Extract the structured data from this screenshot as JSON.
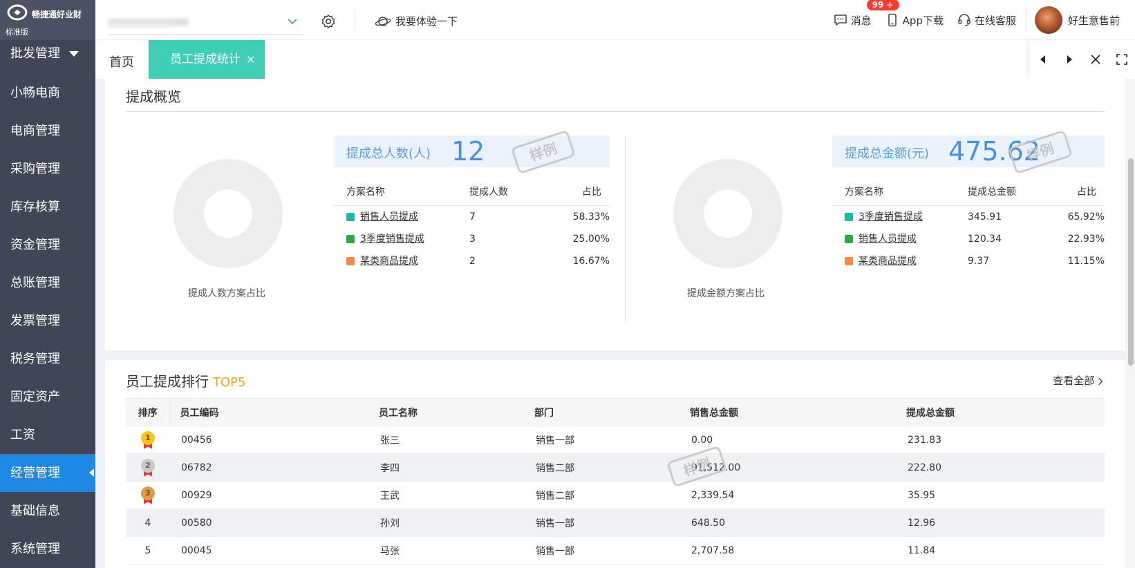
{
  "brand": {
    "name": "畅捷通好业财",
    "edition": "标准版"
  },
  "sidebar": {
    "items": [
      {
        "label": "批发管理"
      },
      {
        "label": "小畅电商"
      },
      {
        "label": "电商管理"
      },
      {
        "label": "采购管理"
      },
      {
        "label": "库存核算"
      },
      {
        "label": "资金管理"
      },
      {
        "label": "总账管理"
      },
      {
        "label": "发票管理"
      },
      {
        "label": "税务管理"
      },
      {
        "label": "固定资产"
      },
      {
        "label": "工资"
      },
      {
        "label": "经营管理"
      },
      {
        "label": "基础信息"
      },
      {
        "label": "系统管理"
      }
    ],
    "active_index": 11
  },
  "header": {
    "try_label": "我要体验一下",
    "messages_label": "消息",
    "messages_badge": "99 +",
    "app_download_label": "App下载",
    "service_label": "在线客服",
    "username": "好生意售前"
  },
  "tabs": {
    "home_label": "首页",
    "active_label": "员工提成统计",
    "close_glyph": "×"
  },
  "overview": {
    "title": "提成概览",
    "stamp_text": "样例",
    "people": {
      "caption": "提成人数方案占比",
      "stat_label": "提成总人数(人)",
      "stat_value": "12",
      "headers": [
        "方案名称",
        "提成人数",
        "占比"
      ],
      "rows": [
        {
          "name": "销售人员提成",
          "value": "7",
          "pct": "58.33%",
          "color": "#1fb8a8"
        },
        {
          "name": "3季度销售提成",
          "value": "3",
          "pct": "25.00%",
          "color": "#2ca843"
        },
        {
          "name": "某类商品提成",
          "value": "2",
          "pct": "16.67%",
          "color": "#f58c42"
        }
      ]
    },
    "amount": {
      "caption": "提成金额方案占比",
      "stat_label": "提成总金额(元)",
      "stat_value": "475.62",
      "headers": [
        "方案名称",
        "提成总金额",
        "占比"
      ],
      "rows": [
        {
          "name": "3季度销售提成",
          "value": "345.91",
          "pct": "65.92%",
          "color": "#1fb8a8"
        },
        {
          "name": "销售人员提成",
          "value": "120.34",
          "pct": "22.93%",
          "color": "#2ca843"
        },
        {
          "name": "某类商品提成",
          "value": "9.37",
          "pct": "11.15%",
          "color": "#f58c42"
        }
      ]
    }
  },
  "ranking": {
    "title": "员工提成排行",
    "title_suffix": "TOP5",
    "view_all": "查看全部",
    "headers": [
      "排序",
      "员工编码",
      "员工名称",
      "部门",
      "销售总金额",
      "提成总金额"
    ],
    "rows": [
      {
        "rank": "1",
        "medal": "gold",
        "code": "00456",
        "name": "张三",
        "dept": "销售一部",
        "sales": "0.00",
        "commission": "231.83"
      },
      {
        "rank": "2",
        "medal": "silver",
        "code": "06782",
        "name": "李四",
        "dept": "销售二部",
        "sales": "91,512.00",
        "commission": "222.80"
      },
      {
        "rank": "3",
        "medal": "bronze",
        "code": "00929",
        "name": "王武",
        "dept": "销售二部",
        "sales": "2,339.54",
        "commission": "35.95"
      },
      {
        "rank": "4",
        "medal": "",
        "code": "00580",
        "name": "孙刘",
        "dept": "销售一部",
        "sales": "648.50",
        "commission": "12.96"
      },
      {
        "rank": "5",
        "medal": "",
        "code": "00045",
        "name": "马张",
        "dept": "销售一部",
        "sales": "2,707.58",
        "commission": "11.84"
      }
    ]
  },
  "colors": {
    "sidebar_bg": "#3f4656",
    "active_nav": "#1e88e5",
    "active_tab": "#3fcfb5",
    "stat_text": "#4a90e2",
    "top5": "#f5a623",
    "medal_gold": "#f5c518",
    "medal_silver": "#c9c9c9",
    "medal_bronze": "#e09a4f"
  }
}
